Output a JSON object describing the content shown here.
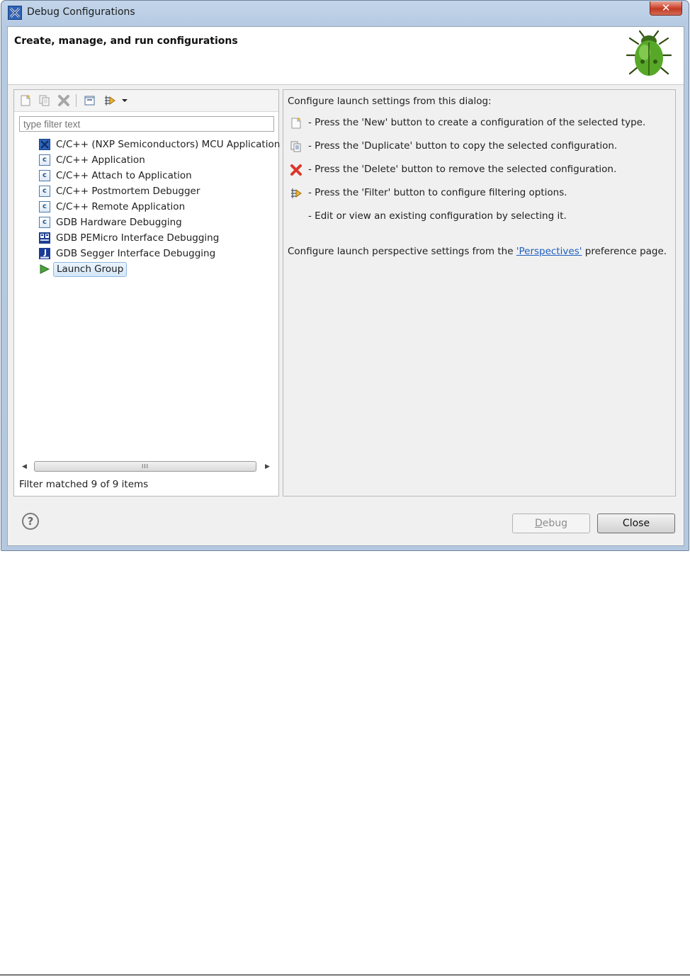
{
  "window": {
    "title": "Debug Configurations",
    "close_glyph": "✕"
  },
  "banner": {
    "title": "Create, manage, and run configurations",
    "icon": "debug-bug-icon"
  },
  "toolbar": {
    "buttons": [
      "new-configuration-icon",
      "duplicate-icon",
      "delete-icon",
      "collapse-all-icon",
      "filter-icon",
      "view-menu-dropdown-icon"
    ]
  },
  "filter": {
    "placeholder": "type filter text",
    "value": ""
  },
  "tree": {
    "items": [
      {
        "label": "C/C++ (NXP Semiconductors) MCU Application",
        "icon": "nxp-mcu-icon"
      },
      {
        "label": "C/C++ Application",
        "icon": "c-app-icon"
      },
      {
        "label": "C/C++ Attach to Application",
        "icon": "c-app-icon"
      },
      {
        "label": "C/C++ Postmortem Debugger",
        "icon": "c-app-icon"
      },
      {
        "label": "C/C++ Remote Application",
        "icon": "c-app-icon"
      },
      {
        "label": "GDB Hardware Debugging",
        "icon": "c-app-icon"
      },
      {
        "label": "GDB PEMicro Interface Debugging",
        "icon": "pemicro-icon"
      },
      {
        "label": "GDB Segger Interface Debugging",
        "icon": "jlink-icon"
      },
      {
        "label": "Launch Group",
        "icon": "launch-group-icon",
        "selected": true
      }
    ]
  },
  "scrollbar": {
    "thumb_grip": "III"
  },
  "status": "Filter matched 9 of 9 items",
  "info": {
    "heading": "Configure launch settings from this dialog:",
    "lines": [
      "- Press the 'New' button to create a configuration of the selected type.",
      "- Press the 'Duplicate' button to copy the selected configuration.",
      "- Press the 'Delete' button to remove the selected configuration.",
      "- Press the 'Filter' button to configure filtering options.",
      "- Edit or view an existing configuration by selecting it."
    ],
    "perspectives_before": "Configure launch perspective settings from the ",
    "perspectives_link": "'Perspectives'",
    "perspectives_after": " preference page."
  },
  "buttons": {
    "help": "?",
    "debug_mnemonic": "D",
    "debug_rest": "ebug",
    "close": "Close"
  }
}
